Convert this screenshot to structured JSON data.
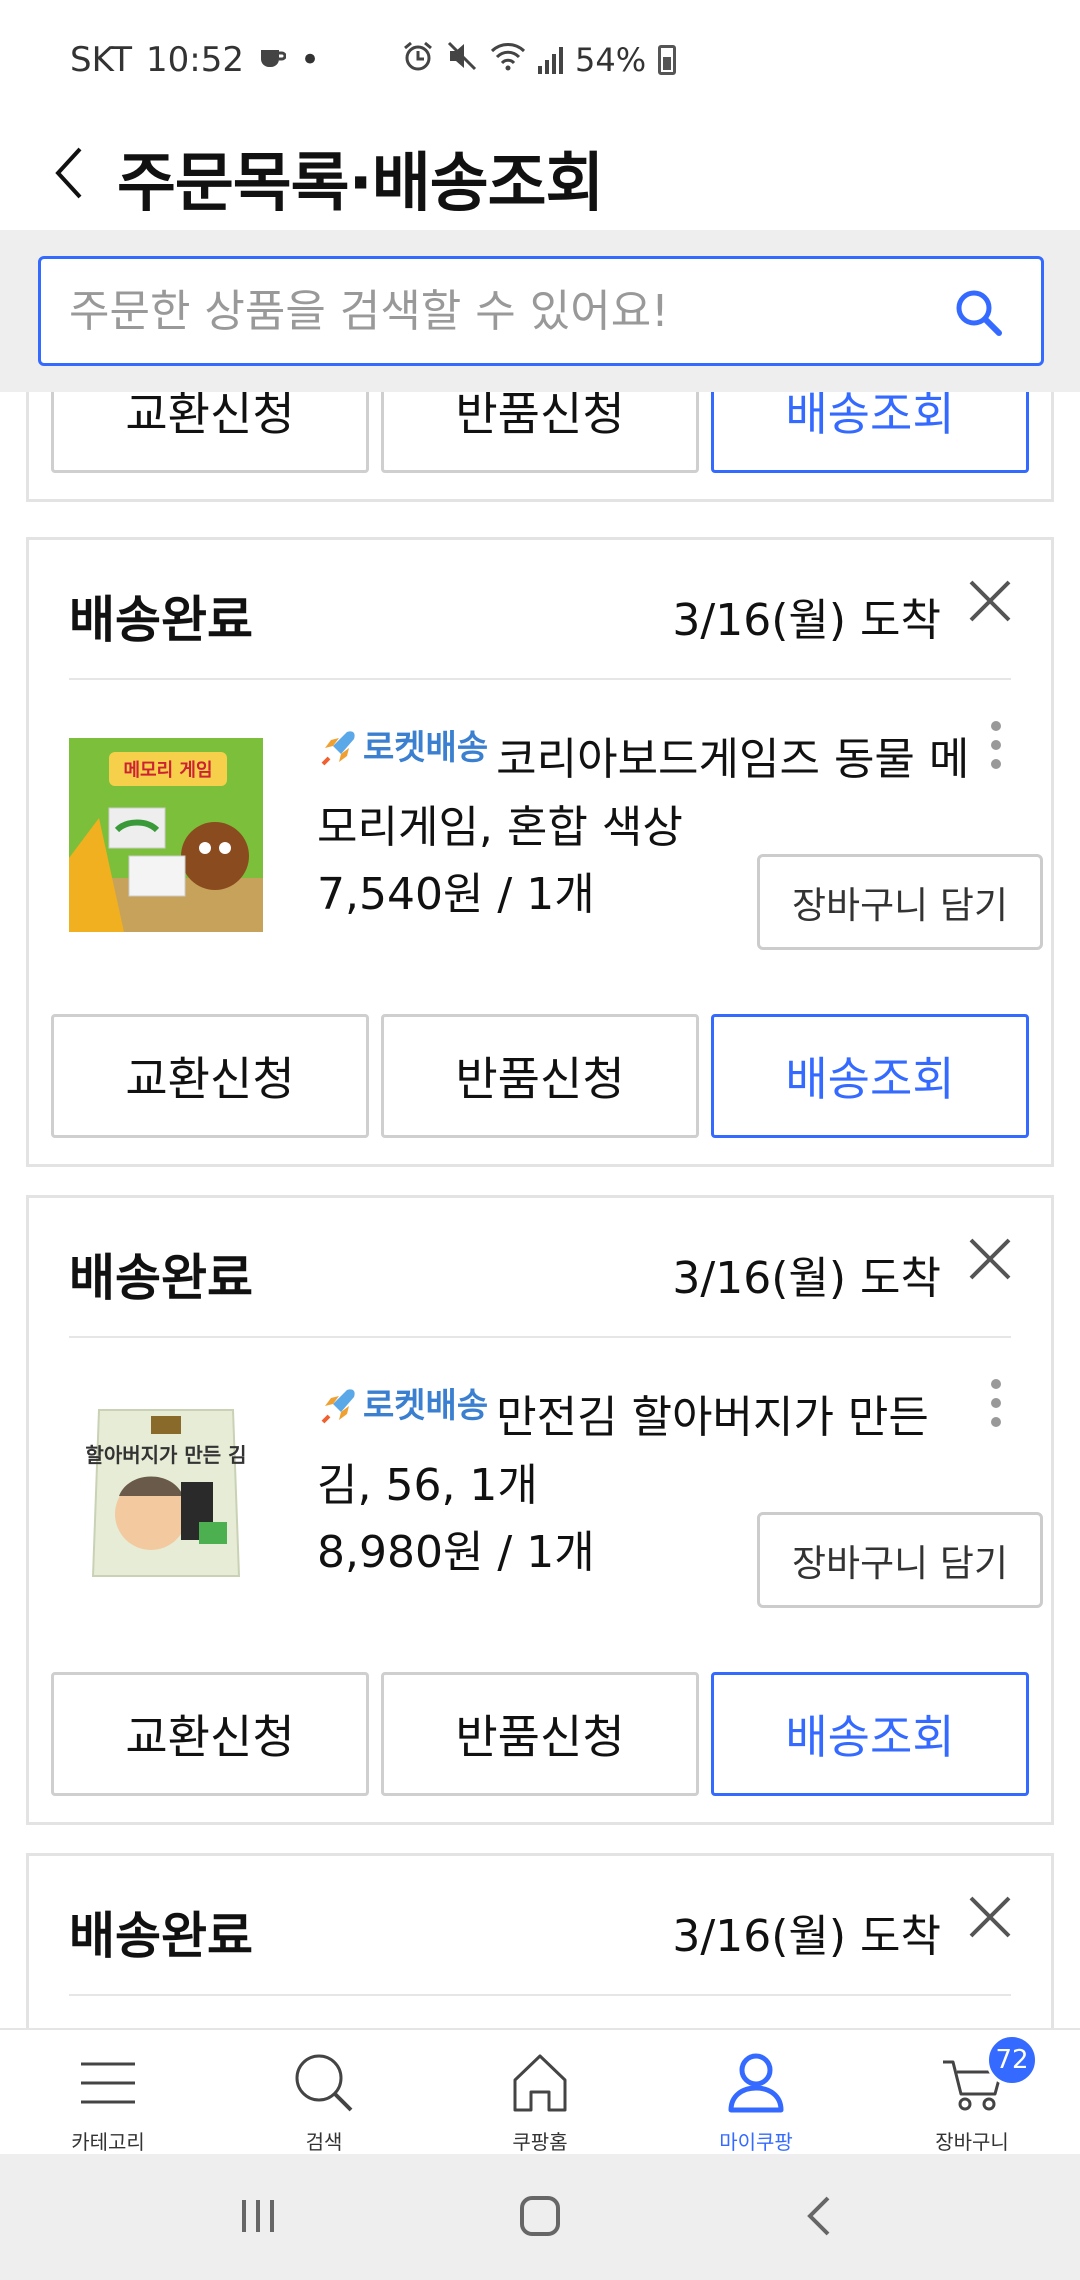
{
  "status_bar": {
    "carrier": "SKT",
    "time": "10:52",
    "dot": "•",
    "battery": "54%"
  },
  "header": {
    "title": "주문목록·배송조회"
  },
  "search": {
    "placeholder": "주문한 상품을 검색할 수 있어요!"
  },
  "partial_card": {
    "actions": [
      "교환신청",
      "반품신청",
      "배송조회"
    ]
  },
  "orders": [
    {
      "status": "배송완료",
      "arrival": "3/16(월) 도착",
      "badge": "로켓배송",
      "name": "코리아보드게임즈 동물 메모리게임, 혼합 색상",
      "price": "7,540원 / 1개",
      "cart_button": "장바구니 담기",
      "thumb_title": "메모리 게임",
      "actions": [
        "교환신청",
        "반품신청",
        "배송조회"
      ]
    },
    {
      "status": "배송완료",
      "arrival": "3/16(월) 도착",
      "badge": "로켓배송",
      "name": "만전김 할아버지가 만든 김, 56, 1개",
      "price": "8,980원 / 1개",
      "cart_button": "장바구니 담기",
      "thumb_title": "할아버지가 만든 김",
      "actions": [
        "교환신청",
        "반품신청",
        "배송조회"
      ]
    },
    {
      "status": "배송완료",
      "arrival": "3/16(월) 도착"
    }
  ],
  "bottom_nav": {
    "items": [
      {
        "label": "카테고리",
        "icon": "menu-icon"
      },
      {
        "label": "검색",
        "icon": "search-icon"
      },
      {
        "label": "쿠팡홈",
        "icon": "home-icon"
      },
      {
        "label": "마이쿠팡",
        "icon": "person-icon",
        "active": true
      },
      {
        "label": "장바구니",
        "icon": "cart-icon",
        "badge": "72"
      }
    ]
  },
  "colors": {
    "accent": "#346aff",
    "rocket": "#3a7fd0",
    "border": "#e3e3e3"
  }
}
